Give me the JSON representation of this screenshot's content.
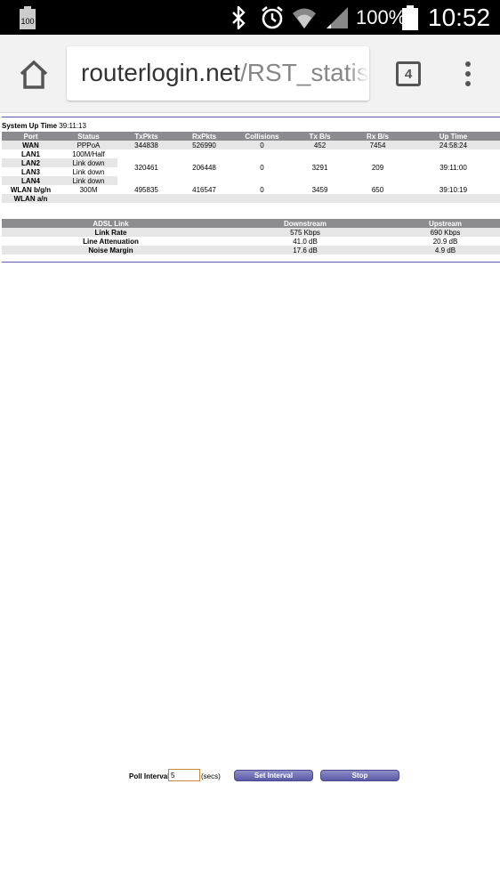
{
  "status_bar": {
    "left_icon": "battery-100-notification-icon",
    "left_icon_text": "100",
    "battery_percent": "100%",
    "time": "10:52"
  },
  "browser": {
    "url_host": "routerlogin.net",
    "url_path": "/RST_statis",
    "tab_count": "4"
  },
  "system": {
    "uptime_label": "System Up Time",
    "uptime_value": "39:11:13"
  },
  "stats_table": {
    "headers": [
      "Port",
      "Status",
      "TxPkts",
      "RxPkts",
      "Collisions",
      "Tx B/s",
      "Rx B/s",
      "Up Time"
    ],
    "wan": {
      "port": "WAN",
      "status": "PPPoA",
      "tx": "344838",
      "rx": "526990",
      "coll": "0",
      "txbs": "452",
      "rxbs": "7454",
      "uptime": "24:58:24"
    },
    "lan_ports": [
      {
        "port": "LAN1",
        "status": "100M/Half"
      },
      {
        "port": "LAN2",
        "status": "Link down"
      },
      {
        "port": "LAN3",
        "status": "Link down"
      },
      {
        "port": "LAN4",
        "status": "Link down"
      }
    ],
    "lan_totals": {
      "tx": "320461",
      "rx": "206448",
      "coll": "0",
      "txbs": "3291",
      "rxbs": "209",
      "uptime": "39:11:00"
    },
    "wlan_bgn": {
      "port": "WLAN b/g/n",
      "status": "300M",
      "tx": "495835",
      "rx": "416547",
      "coll": "0",
      "txbs": "3459",
      "rxbs": "650",
      "uptime": "39:10:19"
    },
    "wlan_an": {
      "port": "WLAN a/n"
    }
  },
  "adsl_table": {
    "headers": [
      "ADSL Link",
      "Downstream",
      "Upstream"
    ],
    "rows": [
      {
        "label": "Link Rate",
        "down": "575 Kbps",
        "up": "690 Kbps"
      },
      {
        "label": "Line Attenuation",
        "down": "41.0 dB",
        "up": "20.9 dB"
      },
      {
        "label": "Noise Margin",
        "down": "17.6 dB",
        "up": "4.9 dB"
      }
    ]
  },
  "poll": {
    "label": "Poll Interval:",
    "value": "5",
    "unit": "(secs)",
    "set_button": "Set Interval",
    "stop_button": "Stop"
  }
}
